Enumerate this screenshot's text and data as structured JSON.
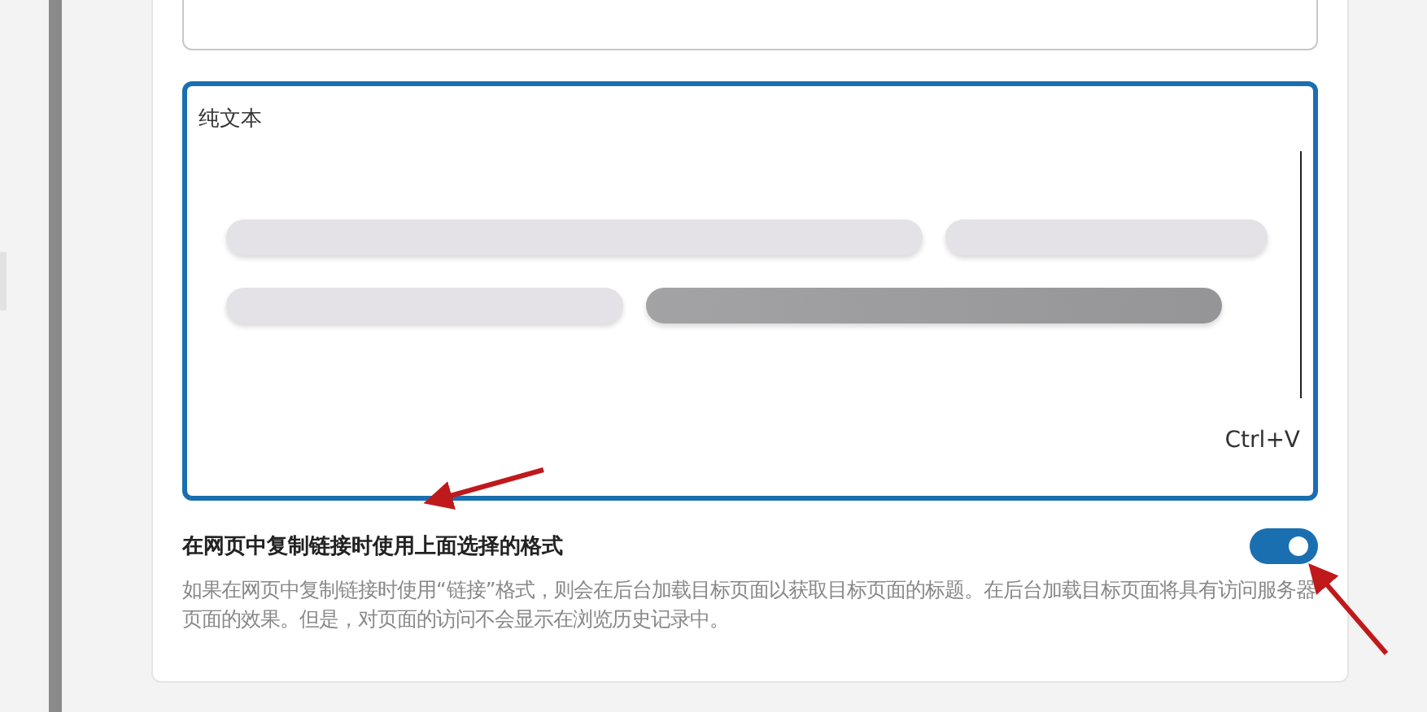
{
  "format_options": [
    {
      "kind": "blank",
      "selected": false
    },
    {
      "kind": "plain",
      "label": "纯文本",
      "shortcut": "Ctrl+V",
      "selected": true
    }
  ],
  "setting": {
    "title": "在网页中复制链接时使用上面选择的格式",
    "description": "如果在网页中复制链接时使用“链接”格式，则会在后台加载目标页面以获取目标页面的标题。在后台加载目标页面将具有访问服务器页面的效果。但是，对页面的访问不会显示在浏览历史记录中。",
    "on": true
  }
}
